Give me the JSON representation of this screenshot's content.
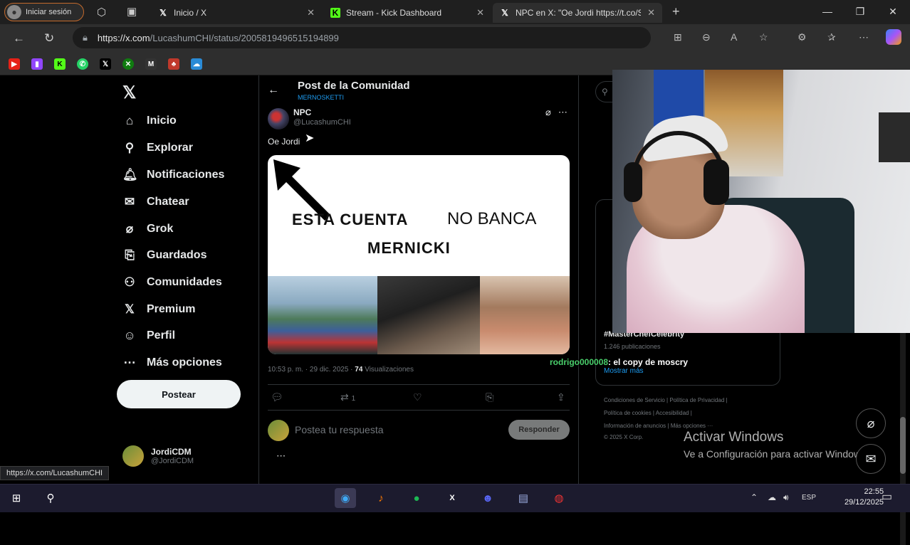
{
  "browser": {
    "signin_label": "Iniciar sesión",
    "tabs": [
      {
        "title": "Inicio / X",
        "favicon": "X",
        "favicon_color": "#ffffff"
      },
      {
        "title": "Stream - Kick Dashboard",
        "favicon": "K",
        "favicon_color": "#53fc18"
      },
      {
        "title": "NPC en X: \"Oe Jordi https://t.co/S",
        "favicon": "X",
        "favicon_color": "#ffffff"
      }
    ],
    "new_tab_icon": "plus-icon",
    "url_host": "https://x.com",
    "url_path": "/LucashumCHI/status/2005819496515194899",
    "bookmarks_icons": [
      "youtube-icon",
      "twitch-icon",
      "kick-icon",
      "whatsapp-icon",
      "x-icon",
      "xbox-icon",
      "m-icon",
      "app-icon",
      "cloud-icon"
    ]
  },
  "sidebar": {
    "logo": "𝕏",
    "items": [
      {
        "label": "Inicio",
        "icon": "⌂"
      },
      {
        "label": "Explorar",
        "icon": "⚲"
      },
      {
        "label": "Notificaciones",
        "icon": "🔔︎"
      },
      {
        "label": "Chatear",
        "icon": "✉"
      },
      {
        "label": "Grok",
        "icon": "⌀"
      },
      {
        "label": "Guardados",
        "icon": "⎘"
      },
      {
        "label": "Comunidades",
        "icon": "⚇"
      },
      {
        "label": "Premium",
        "icon": "𝕏"
      },
      {
        "label": "Perfil",
        "icon": "☺"
      },
      {
        "label": "Más opciones",
        "icon": "⋯"
      }
    ],
    "post_button": "Postear",
    "account": {
      "name": "JordiCDM",
      "handle": "@JordiCDM"
    }
  },
  "post": {
    "header_title": "Post de la Comunidad",
    "community": "MERNOSKETTI",
    "author_name": "NPC",
    "author_handle": "@LucashumCHI",
    "text": "Oe Jordi",
    "meme": {
      "line1": "ESTA CUENTA",
      "line2": "NO BANCA",
      "line3": "MERNICKI"
    },
    "timestamp": "10:53 p. m. · 29 dic. 2025 ·",
    "views_count": "74",
    "views_label": "Visualizaciones",
    "retweets": "1",
    "reply_placeholder": "Postea tu respuesta",
    "reply_button": "Responder"
  },
  "right": {
    "trend_tag": "#MasterChefCelebrity",
    "trend_count": "1.246 publicaciones",
    "show_more": "Mostrar más",
    "footer": [
      "Condiciones de Servicio  |  Política de Privacidad  |",
      "Política de cookies  |  Accesibilidad  |",
      "Información de anuncios  |  Más opciones ···",
      "© 2025 X Corp."
    ]
  },
  "overlay": {
    "chat_user": "rodrigo000008",
    "chat_message": ": el copy de moscry",
    "activate_title": "Activar Windows",
    "activate_sub": "Ve a Configuración para activar Windows."
  },
  "status_url": "https://x.com/LucashumCHI",
  "taskbar": {
    "lang": "ESP",
    "time": "22:55",
    "date": "29/12/2025"
  }
}
